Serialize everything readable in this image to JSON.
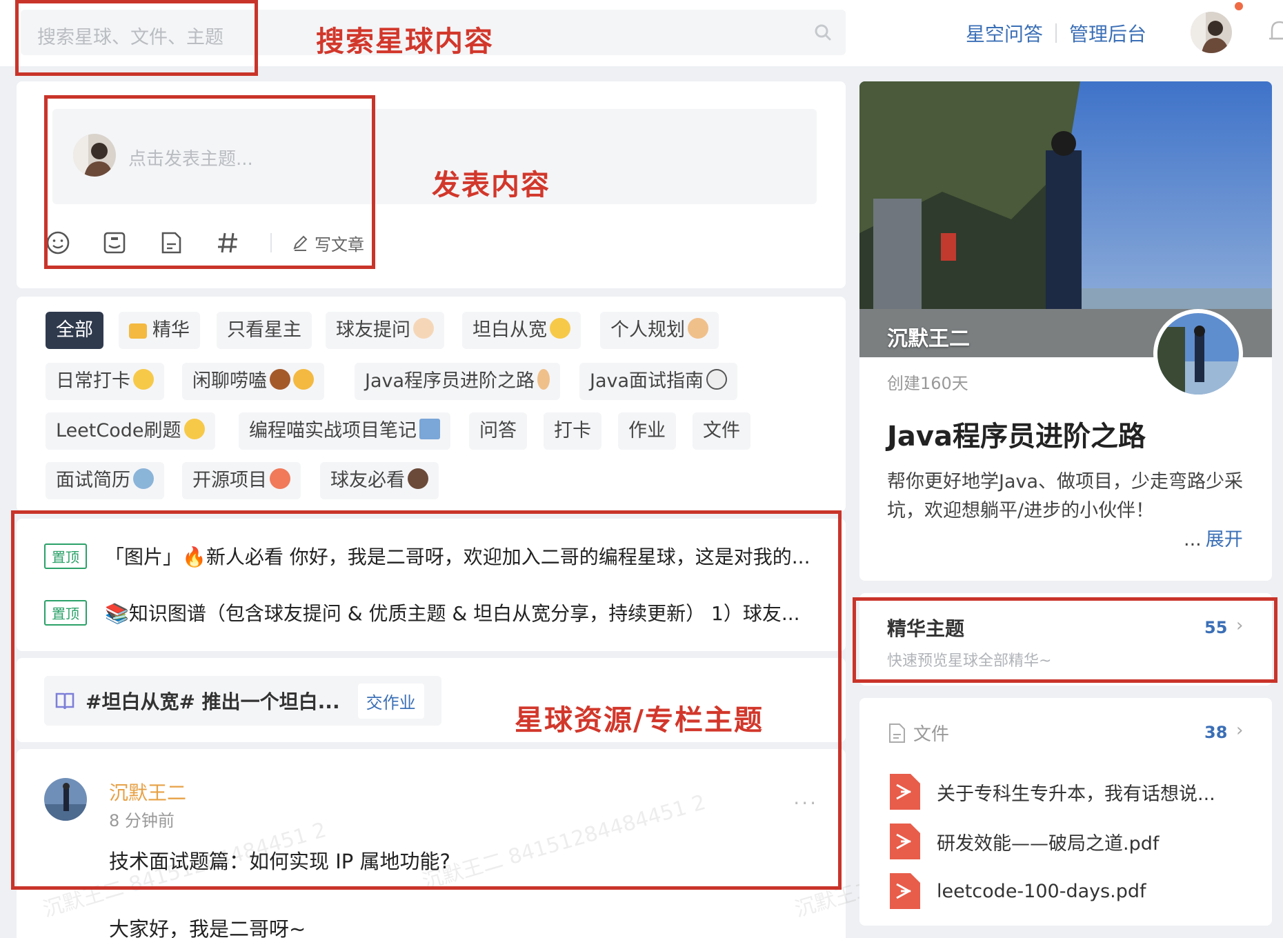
{
  "search": {
    "placeholder": "搜索星球、文件、主题"
  },
  "top_links": {
    "qa": "星空问答",
    "admin": "管理后台"
  },
  "annotations": {
    "search": "搜索星球内容",
    "post": "发表内容",
    "resources": "星球资源/专栏主题"
  },
  "composer": {
    "placeholder": "点击发表主题...",
    "write_article": "写文章"
  },
  "tags": [
    {
      "label": "全部",
      "active": true
    },
    {
      "label": "精华"
    },
    {
      "label": "只看星主"
    },
    {
      "label": "球友提问"
    },
    {
      "label": "坦白从宽"
    },
    {
      "label": "个人规划"
    },
    {
      "label": "日常打卡"
    },
    {
      "label": "闲聊唠嗑"
    },
    {
      "label": "Java程序员进阶之路"
    },
    {
      "label": "Java面试指南"
    },
    {
      "label": "LeetCode刷题"
    },
    {
      "label": "编程喵实战项目笔记"
    },
    {
      "label": "问答"
    },
    {
      "label": "打卡"
    },
    {
      "label": "作业"
    },
    {
      "label": "文件"
    },
    {
      "label": "面试简历"
    },
    {
      "label": "开源项目"
    },
    {
      "label": "球友必看"
    }
  ],
  "pinned": [
    {
      "badge": "置顶",
      "text": "「图片」🔥新人必看 你好，我是二哥呀，欢迎加入二哥的编程星球，这是对我的..."
    },
    {
      "badge": "置顶",
      "text": "📚知识图谱（包含球友提问 & 优质主题 & 坦白从宽分享，持续更新） 1）球友..."
    }
  ],
  "column": {
    "title": "#坦白从宽# 推出一个坦白...",
    "action": "交作业"
  },
  "post": {
    "author": "沉默王二",
    "time": "8 分钟前",
    "title": "技术面试题篇：如何实现 IP 属地功能?",
    "body": "大家好，我是二哥呀~",
    "more": "···",
    "watermark": "沉默王二 84151284484451 2"
  },
  "profile": {
    "cover_name": "沉默王二",
    "created": "创建160天",
    "title": "Java程序员进阶之路",
    "description": "帮你更好地学Java、做项目，少走弯路少采坑，欢迎想躺平/进步的小伙伴！",
    "expand_dots": "...",
    "expand": "展开"
  },
  "essence": {
    "title": "精华主题",
    "subtitle": "快速预览星球全部精华~",
    "count": "55"
  },
  "files": {
    "title": "文件",
    "count": "38",
    "items": [
      {
        "name": "关于专科生专升本，我有话想说..."
      },
      {
        "name": "研发效能——破局之道.pdf"
      },
      {
        "name": "leetcode-100-days.pdf"
      }
    ]
  },
  "colors": {
    "annotation_red": "#c9342a",
    "link_blue": "#3b6fb6",
    "pin_green": "#2aa168",
    "author_orange": "#e7a146",
    "active_tag": "#2f3a4d",
    "pdf_red": "#e85d4a"
  }
}
